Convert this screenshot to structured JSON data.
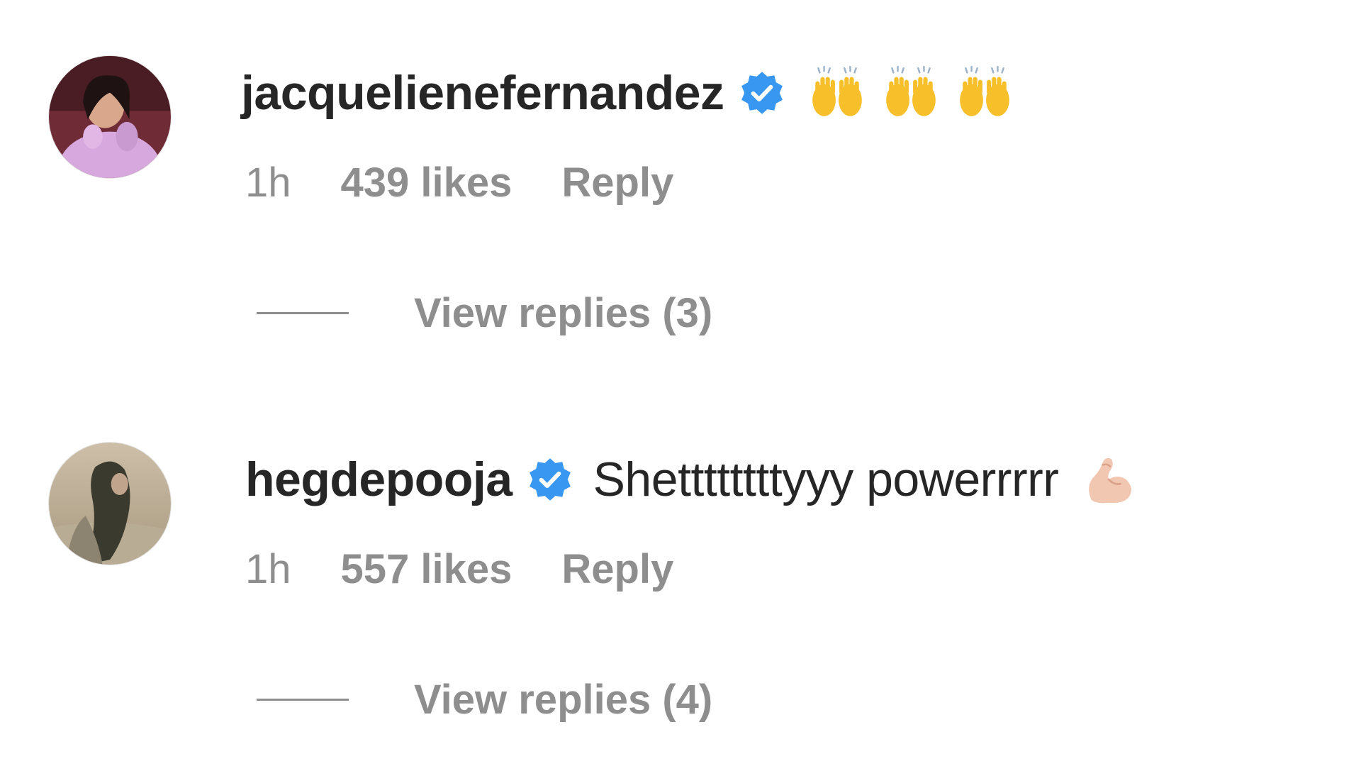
{
  "comments": [
    {
      "username": "jacquelienefernandez",
      "verified_icon": "verified-badge-icon",
      "text": "",
      "emoji": [
        "raising-hands-emoji",
        "raising-hands-emoji",
        "raising-hands-emoji"
      ],
      "time": "1h",
      "likes": "439 likes",
      "reply_label": "Reply",
      "view_replies_label": "View replies (3)"
    },
    {
      "username": "hegdepooja",
      "verified_icon": "verified-badge-icon",
      "text": "Shettttttttyyy powerrrrr",
      "emoji": [
        "flexed-biceps-emoji"
      ],
      "time": "1h",
      "likes": "557 likes",
      "reply_label": "Reply",
      "view_replies_label": "View replies (4)"
    }
  ],
  "colors": {
    "username": "#262626",
    "meta": "#8e8e8e",
    "verified": "#3897f0",
    "background": "#ffffff"
  }
}
